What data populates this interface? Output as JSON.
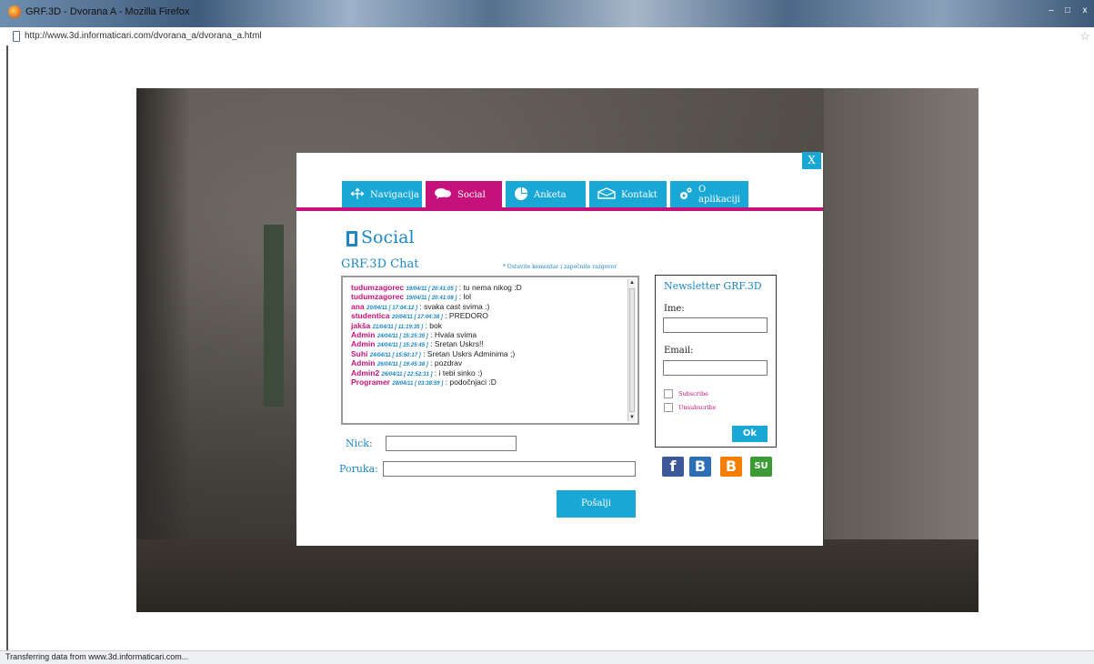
{
  "window": {
    "title": "GRF.3D - Dvorana A - Mozilla Firefox",
    "url": "http://www.3d.informaticari.com/dvorana_a/dvorana_a.html",
    "status": "Transferring data from www.3d.informaticari.com..."
  },
  "modal": {
    "close_label": "X",
    "tabs": [
      {
        "label": "Navigacija",
        "icon": "navigation-arrows-icon"
      },
      {
        "label": "Social",
        "icon": "speech-bubbles-icon"
      },
      {
        "label": "Anketa",
        "icon": "pie-chart-icon"
      },
      {
        "label": "Kontakt",
        "icon": "envelope-icon"
      },
      {
        "label": "O aplikaciji",
        "icon": "gears-icon"
      }
    ],
    "active_tab": "Social",
    "section_title": "Social"
  },
  "chat": {
    "title": "GRF.3D Chat",
    "hint": "* Ostavite komentar i započnite razgovor",
    "messages": [
      {
        "user": "tudumzagorec",
        "time": "19/04/11 [ 20:41:05 ]",
        "text": ": tu nema nikog :D"
      },
      {
        "user": "tudumzagorec",
        "time": "19/04/11 [ 20:41:08 ]",
        "text": ": lol"
      },
      {
        "user": "ana",
        "time": "20/04/11 [ 17:04:12 ]",
        "text": ": svaka cast svima :)"
      },
      {
        "user": "studentica",
        "time": "20/04/11 [ 17:04:38 ]",
        "text": ": PREDORO"
      },
      {
        "user": "jakša",
        "time": "21/04/11 [ 11:19:35 ]",
        "text": ": bok"
      },
      {
        "user": "Admin",
        "time": "24/04/11 [ 15:25:35 ]",
        "text": ": Hvala svima"
      },
      {
        "user": "Admin",
        "time": "24/04/11 [ 15:25:45 ]",
        "text": ": Sretan Uskrs!!"
      },
      {
        "user": "Suhi",
        "time": "24/04/11 [ 15:50:17 ]",
        "text": ": Sretan Uskrs Adminima ;)"
      },
      {
        "user": "Admin",
        "time": "26/04/11 [ 19:45:38 ]",
        "text": ": pozdrav"
      },
      {
        "user": "Admin2",
        "time": "26/04/11 [ 22:52:31 ]",
        "text": ": i tebi sinko :)"
      },
      {
        "user": "Programer",
        "time": "28/04/11 [ 03:38:59 ]",
        "text": ": podočnjaci :D"
      }
    ],
    "nick_label": "Nick:",
    "nick_value": "",
    "message_label": "Poruka:",
    "message_value": "",
    "send_label": "Pošalji"
  },
  "newsletter": {
    "title": "Newsletter GRF.3D",
    "name_label": "Ime:",
    "name_value": "",
    "email_label": "Email:",
    "email_value": "",
    "subscribe_label": "Subscribe",
    "subscribe_checked": false,
    "unsubscribe_label": "Unsubscribe",
    "unsubscribe_checked": false,
    "ok_label": "Ok"
  },
  "social_links": [
    {
      "name": "facebook-icon",
      "glyph": "f",
      "color": "#3b5998"
    },
    {
      "name": "blogger-b-icon",
      "glyph": "B",
      "color": "#2d6fb5"
    },
    {
      "name": "blogger-icon",
      "glyph": "B",
      "color": "#f57d00"
    },
    {
      "name": "stumbleupon-icon",
      "glyph": "SU",
      "color": "#3d9b35"
    }
  ],
  "colors": {
    "accent_blue": "#19a7d6",
    "accent_magenta": "#c5127a",
    "text_blue": "#1a87c4"
  }
}
